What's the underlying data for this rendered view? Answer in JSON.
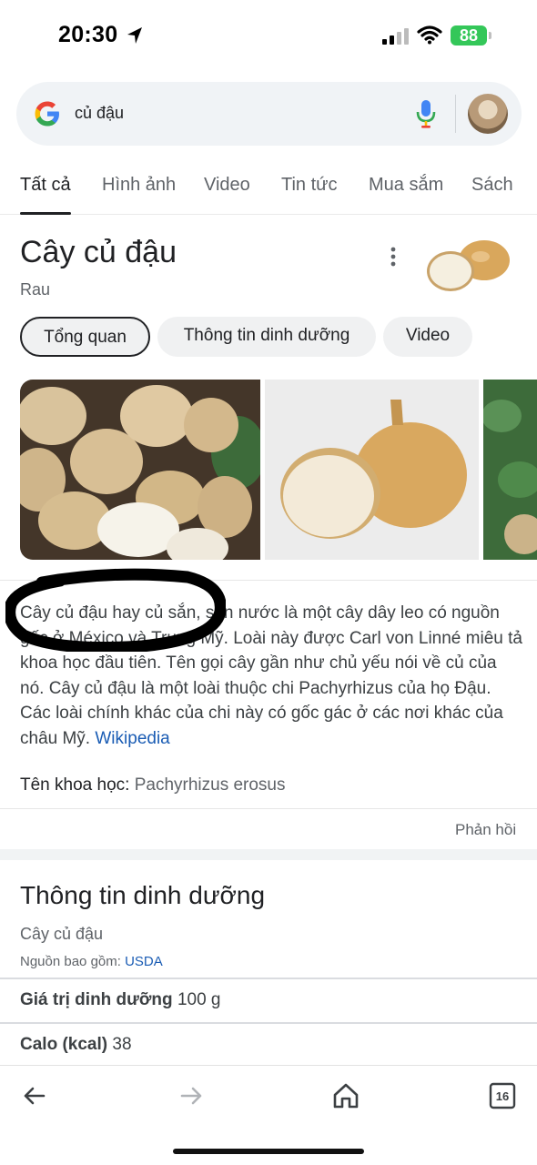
{
  "status_bar": {
    "time": "20:30",
    "battery": "88"
  },
  "search": {
    "query": "củ đậu"
  },
  "tabs": [
    "Tất cả",
    "Hình ảnh",
    "Video",
    "Tin tức",
    "Mua sắm",
    "Sách"
  ],
  "knowledge_panel": {
    "title": "Cây củ đậu",
    "subtitle": "Rau",
    "chips": [
      "Tổng quan",
      "Thông tin dinh dưỡng",
      "Video"
    ],
    "description_parts": [
      "Cây củ đậu hay củ sắn, sắn nước là một cây dây leo có nguồn gốc ở México và Trung Mỹ. Loài này được Carl von Linné miêu tả khoa học đầu tiên. Tên gọi cây gần như chủ yếu nói về củ của nó. Cây củ đậu là một loài thuộc chi Pachyrhizus của họ Đậu. Các loài chính khác của chi này có gốc gác ở các nơi khác của châu Mỹ. ",
      "Wikipedia"
    ],
    "scientific_name_label": "Tên khoa học:",
    "scientific_name_value": "Pachyrhizus erosus",
    "feedback": "Phản hồi"
  },
  "nutrition": {
    "title": "Thông tin dinh dưỡng",
    "subtitle": "Cây củ đậu",
    "source_label": "Nguồn bao gồm:",
    "source_link": "USDA",
    "rows": [
      {
        "label": "Giá trị dinh dưỡng",
        "value": "100 g"
      },
      {
        "label": "Calo (kcal)",
        "value": "38"
      }
    ]
  },
  "toolbar": {
    "tab_count": "16"
  },
  "colors": {
    "link": "#1a5cb4",
    "battery": "#34c759"
  }
}
